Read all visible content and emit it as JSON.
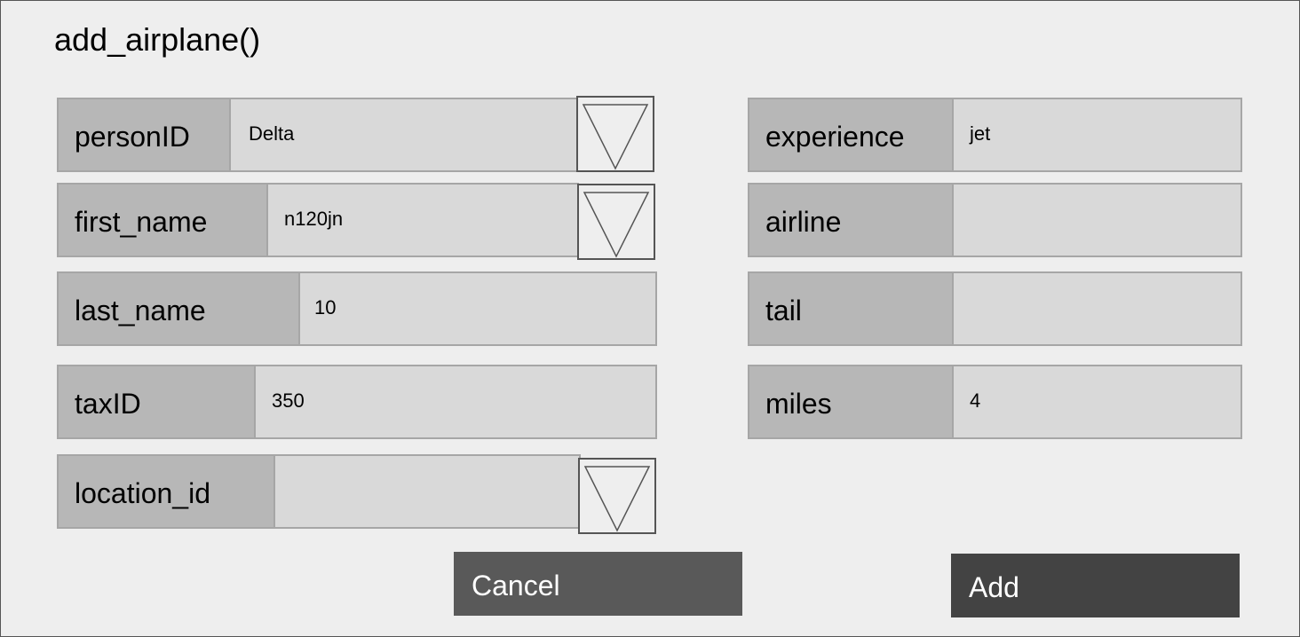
{
  "window": {
    "title": "add_airplane()"
  },
  "left_fields": [
    {
      "label": "personID",
      "value": "Delta",
      "has_dropdown": true
    },
    {
      "label": "first_name",
      "value": "n120jn",
      "has_dropdown": true
    },
    {
      "label": "last_name",
      "value": "10",
      "has_dropdown": false
    },
    {
      "label": "taxID",
      "value": "350",
      "has_dropdown": false
    },
    {
      "label": "location_id",
      "value": "",
      "has_dropdown": true
    }
  ],
  "right_fields": [
    {
      "label": "experience",
      "value": "jet"
    },
    {
      "label": "airline",
      "value": ""
    },
    {
      "label": "tail",
      "value": ""
    },
    {
      "label": "miles",
      "value": "4"
    }
  ],
  "buttons": {
    "cancel_label": "Cancel",
    "add_label": "Add"
  },
  "icons": {
    "dropdown": "triangle-down-icon"
  },
  "colors": {
    "background": "#eeeeee",
    "label_bg": "#b7b7b7",
    "input_bg": "#d9d9d9",
    "cancel_bg": "#595959",
    "add_bg": "#434343"
  }
}
